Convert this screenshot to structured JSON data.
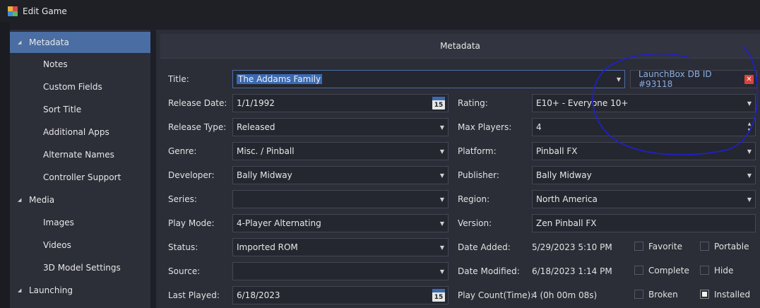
{
  "window": {
    "title": "Edit Game"
  },
  "sidebar": {
    "items": [
      {
        "label": "Metadata",
        "level": 0,
        "active": true
      },
      {
        "label": "Notes",
        "level": 1
      },
      {
        "label": "Custom Fields",
        "level": 1
      },
      {
        "label": "Sort Title",
        "level": 1
      },
      {
        "label": "Additional Apps",
        "level": 1
      },
      {
        "label": "Alternate Names",
        "level": 1
      },
      {
        "label": "Controller Support",
        "level": 1
      },
      {
        "label": "Media",
        "level": 0
      },
      {
        "label": "Images",
        "level": 1
      },
      {
        "label": "Videos",
        "level": 1
      },
      {
        "label": "3D Model Settings",
        "level": 1
      },
      {
        "label": "Launching",
        "level": 0
      }
    ]
  },
  "panel": {
    "header": "Metadata",
    "title": {
      "label": "Title:",
      "value": "The Addams Family"
    },
    "dbid": "LaunchBox DB ID #93118",
    "left": [
      {
        "label": "Release Date:",
        "value": "1/1/1992",
        "kind": "date",
        "cal_num": "15"
      },
      {
        "label": "Release Type:",
        "value": "Released",
        "kind": "combo"
      },
      {
        "label": "Genre:",
        "value": "Misc. / Pinball",
        "kind": "combo"
      },
      {
        "label": "Developer:",
        "value": "Bally Midway",
        "kind": "combo"
      },
      {
        "label": "Series:",
        "value": "",
        "kind": "combo"
      },
      {
        "label": "Play Mode:",
        "value": "4-Player Alternating",
        "kind": "combo"
      },
      {
        "label": "Status:",
        "value": "Imported ROM",
        "kind": "combo"
      },
      {
        "label": "Source:",
        "value": "",
        "kind": "combo"
      },
      {
        "label": "Last Played:",
        "value": "6/18/2023",
        "kind": "date",
        "cal_num": "15"
      }
    ],
    "right": [
      {
        "label": "Rating:",
        "value": "E10+ - Everyone 10+",
        "kind": "combo"
      },
      {
        "label": "Max Players:",
        "value": "4",
        "kind": "spin"
      },
      {
        "label": "Platform:",
        "value": "Pinball FX",
        "kind": "combo"
      },
      {
        "label": "Publisher:",
        "value": "Bally Midway",
        "kind": "combo"
      },
      {
        "label": "Region:",
        "value": "North America",
        "kind": "combo"
      },
      {
        "label": "Version:",
        "value": "Zen Pinball FX",
        "kind": "text"
      },
      {
        "label": "Date Added:",
        "value": "5/29/2023 5:10 PM",
        "kind": "plain"
      },
      {
        "label": "Date Modified:",
        "value": "6/18/2023 1:14 PM",
        "kind": "plain"
      },
      {
        "label": "Play Count(Time):",
        "value": "4 (0h 00m 08s)",
        "kind": "plain"
      }
    ],
    "checkboxes": [
      {
        "label": "Favorite",
        "checked": false
      },
      {
        "label": "Portable",
        "checked": false
      },
      {
        "label": "Complete",
        "checked": false
      },
      {
        "label": "Hide",
        "checked": false
      },
      {
        "label": "Broken",
        "checked": false
      },
      {
        "label": "Installed",
        "checked": true
      }
    ]
  },
  "colors": {
    "accent": "#4a6ea3",
    "annotation": "#1f1fd6",
    "close": "#d8433b",
    "link": "#8aaee0"
  }
}
